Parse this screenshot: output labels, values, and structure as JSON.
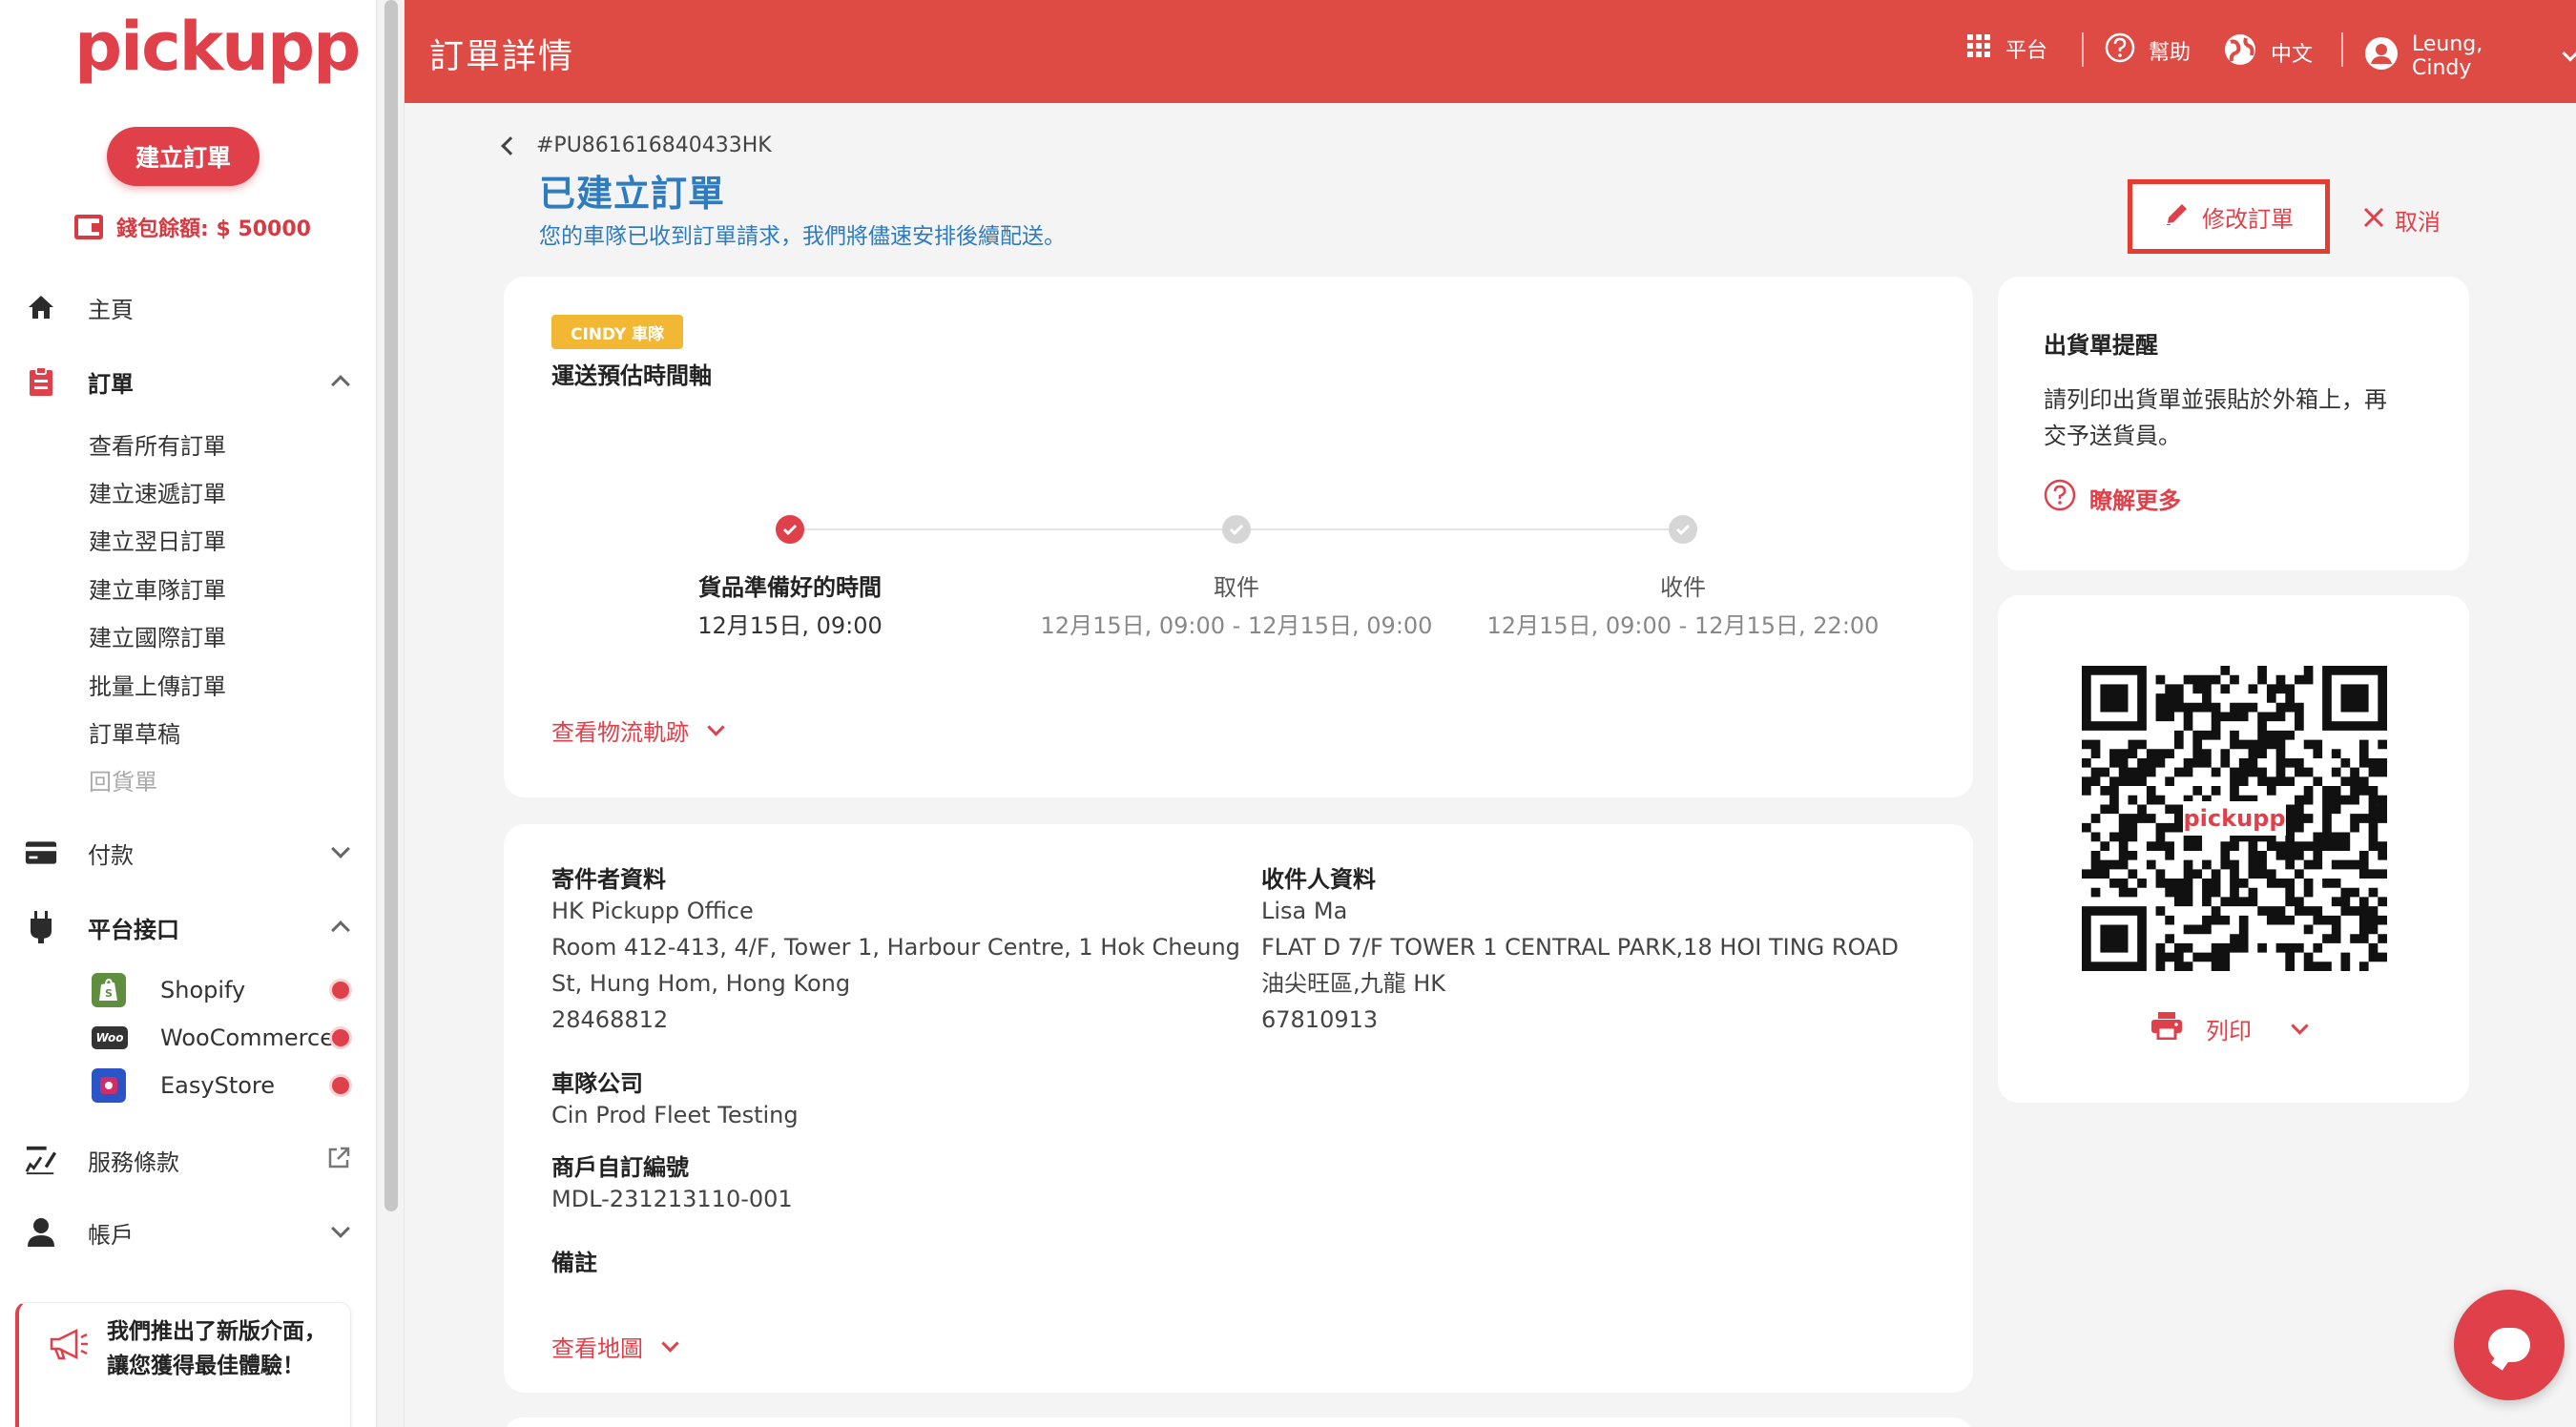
{
  "app": {
    "logo_text": "pickupp",
    "create_order": "建立訂單",
    "wallet_label": "錢包餘額: $ 50000"
  },
  "nav": {
    "home": "主頁",
    "orders": "訂單",
    "order_items": [
      "查看所有訂單",
      "建立速遞訂單",
      "建立翌日訂單",
      "建立車隊訂單",
      "建立國際訂單",
      "批量上傳訂單",
      "訂單草稿",
      "回貨單"
    ],
    "payment": "付款",
    "platforms": "平台接口",
    "platform_items": [
      {
        "label": "Shopify",
        "icon": "shopify-icon",
        "color": "#5e8e3e"
      },
      {
        "label": "WooCommerce",
        "icon": "woocommerce-icon",
        "color": "#333333"
      },
      {
        "label": "EasyStore",
        "icon": "easystore-icon",
        "color": "#d12c6a"
      }
    ],
    "terms": "服務條款",
    "account": "帳戶",
    "promo": "我們推出了新版介面，讓您獲得最佳體驗！"
  },
  "header": {
    "title": "訂單詳情",
    "platform": "平台",
    "help": "幫助",
    "language": "中文",
    "user": "Leung, Cindy"
  },
  "order": {
    "back_id": "#PU861616840433HK",
    "status_title": "已建立訂單",
    "status_sub": "您的車隊已收到訂單請求，我們將儘速安排後續配送。",
    "edit": "修改訂單",
    "cancel": "取消"
  },
  "timeline": {
    "tag": "CINDY 車隊",
    "title": "運送預估時間軸",
    "steps": [
      {
        "label": "貨品準備好的時間",
        "time": "12月15日, 09:00",
        "done": true
      },
      {
        "label": "取件",
        "time": "12月15日, 09:00 - 12月15日, 09:00",
        "done": false
      },
      {
        "label": "收件",
        "time": "12月15日, 09:00 - 12月15日, 22:00",
        "done": false
      }
    ],
    "tracking_link": "查看物流軌跡"
  },
  "details": {
    "sender_h": "寄件者資料",
    "sender_name": "HK Pickupp Office",
    "sender_addr1": "Room 412-413, 4/F, Tower 1, Harbour Centre, 1 Hok Cheung",
    "sender_addr2": "St, Hung Hom, Hong Kong",
    "sender_phone": "28468812",
    "receiver_h": "收件人資料",
    "receiver_name": "Lisa Ma",
    "receiver_addr1": "FLAT D 7/F TOWER 1 CENTRAL PARK,18 HOI TING ROAD",
    "receiver_addr2": "油尖旺區,九龍 HK",
    "receiver_phone": "67810913",
    "fleet_h": "車隊公司",
    "fleet": "Cin Prod Fleet Testing",
    "merchant_h": "商戶自訂編號",
    "merchant_ref": "MDL-231213110-001",
    "remark_h": "備註",
    "map_link": "查看地圖"
  },
  "reminder": {
    "title": "出貨單提醒",
    "text1": "請列印出貨單並張貼於外箱上，再",
    "text2": "交予送貨員。",
    "learn_more": "瞭解更多"
  },
  "qr": {
    "logo_text": "pickupp",
    "print": "列印"
  },
  "colors": {
    "brand": "#dd4b44",
    "accent_red": "#e0404a",
    "link_blue": "#2f7bbf",
    "tag_yellow": "#f2b733"
  }
}
